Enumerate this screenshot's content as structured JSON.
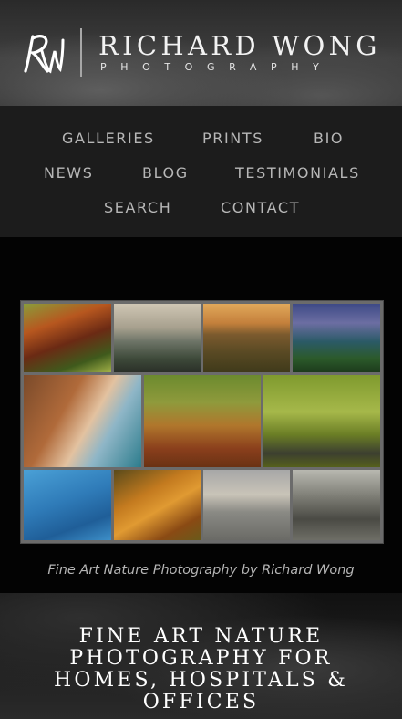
{
  "header": {
    "logo_monogram": "RW",
    "brand_name": "RICHARD WONG",
    "brand_sub": "PHOTOGRAPHY"
  },
  "nav": {
    "items": [
      "GALLERIES",
      "PRINTS",
      "BIO",
      "NEWS",
      "BLOG",
      "TESTIMONIALS",
      "SEARCH",
      "CONTACT"
    ]
  },
  "collage": {
    "tiles": [
      "redwood-forest",
      "cypress-coast",
      "vineyard-rows",
      "river-canyon",
      "coastal-waterfall",
      "autumn-farm-road",
      "oak-tree-lane",
      "ocean-surface",
      "autumn-maple",
      "misty-lake",
      "cypress-tunnel"
    ]
  },
  "caption": "Fine Art Nature Photography by Richard Wong",
  "hero": {
    "title": "FINE ART NATURE PHOTOGRAPHY FOR HOMES, HOSPITALS & OFFICES"
  }
}
